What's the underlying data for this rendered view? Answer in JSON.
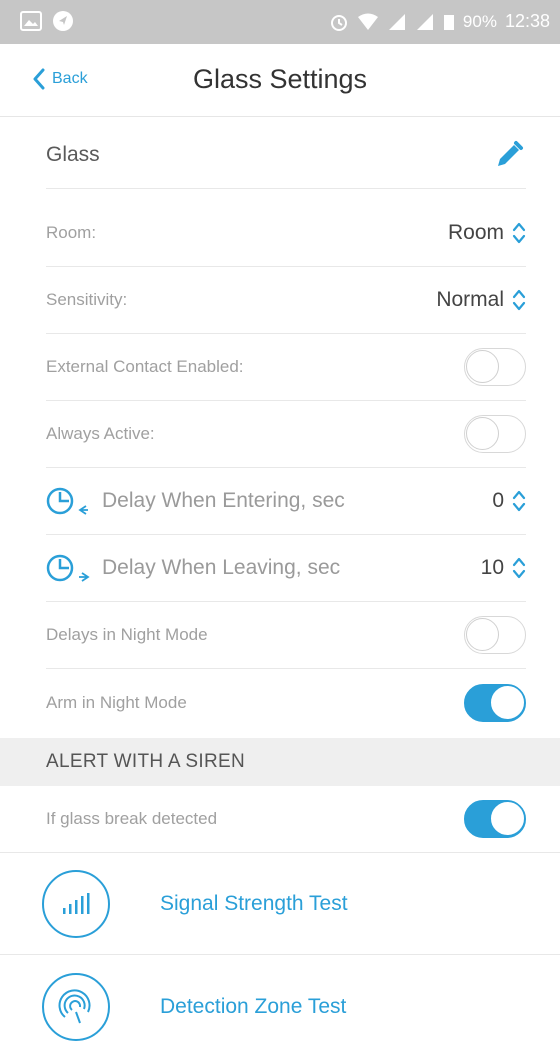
{
  "status_bar": {
    "battery_percent": "90%",
    "time": "12:38"
  },
  "nav": {
    "back_label": "Back",
    "title": "Glass Settings"
  },
  "device": {
    "name": "Glass"
  },
  "settings": {
    "room_label": "Room:",
    "room_value": "Room",
    "sensitivity_label": "Sensitivity:",
    "sensitivity_value": "Normal",
    "external_contact_label": "External Contact Enabled:",
    "external_contact_on": false,
    "always_active_label": "Always Active:",
    "always_active_on": false,
    "delay_entering_label": "Delay When Entering, sec",
    "delay_entering_value": "0",
    "delay_leaving_label": "Delay When Leaving, sec",
    "delay_leaving_value": "10",
    "delays_night_label": "Delays in Night Mode",
    "delays_night_on": false,
    "arm_night_label": "Arm in Night Mode",
    "arm_night_on": true
  },
  "siren_section": {
    "header": "ALERT WITH A SIREN",
    "glass_break_label": "If glass break detected",
    "glass_break_on": true
  },
  "tests": {
    "signal_label": "Signal Strength Test",
    "detection_label": "Detection Zone Test"
  },
  "colors": {
    "accent": "#2a9fd8",
    "statusbar": "#c6c6c6",
    "section_bg": "#efefef"
  }
}
